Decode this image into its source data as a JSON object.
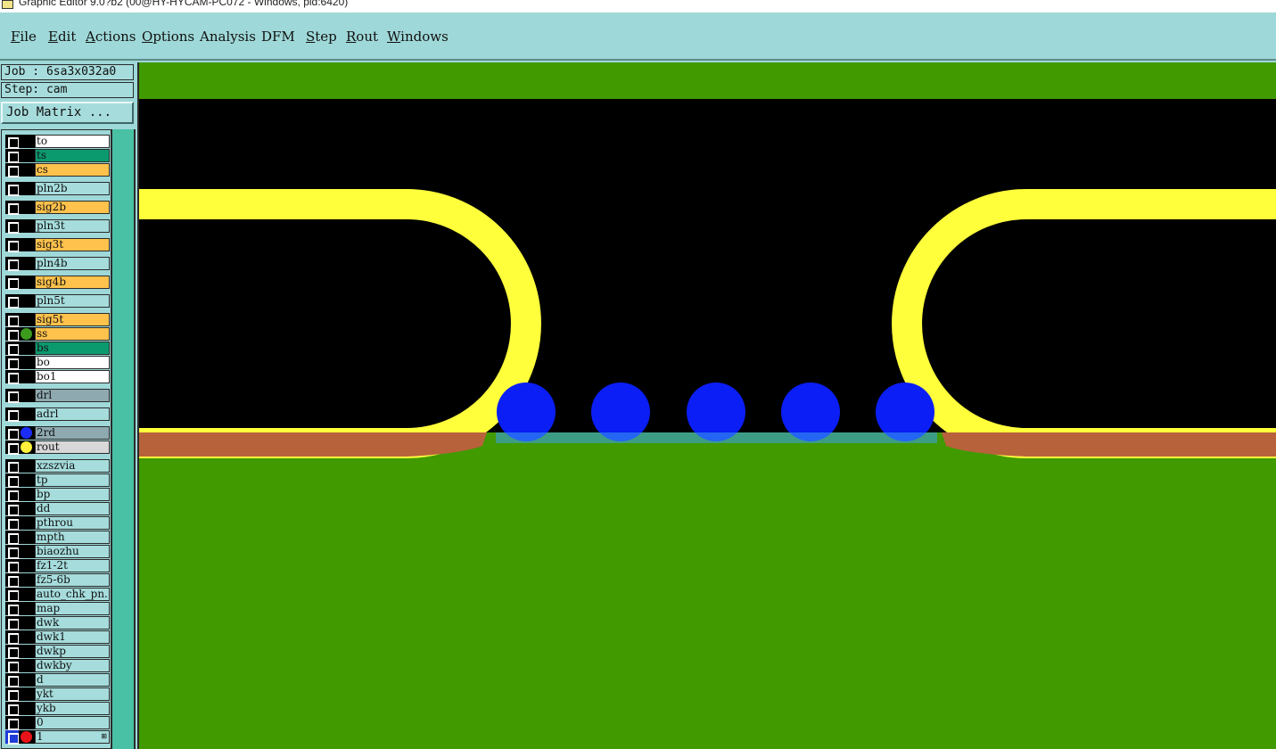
{
  "window": {
    "title": "Graphic Editor 9.0?b2 (00@HY-HYCAM-PC072 - Windows, pid:6420)"
  },
  "menu": [
    {
      "label": "File",
      "underline": "F",
      "rest": "ile"
    },
    {
      "label": "Edit",
      "underline": "E",
      "rest": "dit"
    },
    {
      "label": "Actions",
      "underline": "A",
      "rest": "ctions"
    },
    {
      "label": "Options",
      "underline": "O",
      "rest": "ptions"
    },
    {
      "label": "Analysis",
      "underline": "",
      "rest": "Analysis"
    },
    {
      "label": "DFM",
      "underline": "",
      "rest": "DFM"
    },
    {
      "label": "Step",
      "underline": "S",
      "rest": "tep"
    },
    {
      "label": "Rout",
      "underline": "R",
      "rest": "out"
    },
    {
      "label": "Windows",
      "underline": "W",
      "rest": "indows"
    }
  ],
  "job": {
    "job_line": "Job : 6sa3x032a0",
    "step_line": "Step: cam",
    "matrix_button": "Job Matrix ..."
  },
  "layers": [
    {
      "name": "to",
      "bg": "#ffffff",
      "dot": ""
    },
    {
      "name": "ts",
      "bg": "#0b9a6e",
      "dot": ""
    },
    {
      "name": "cs",
      "bg": "#ffc24c",
      "dot": ""
    },
    {
      "name": "pln2b",
      "bg": "#a6dcdc",
      "dot": ""
    },
    {
      "name": "sig2b",
      "bg": "#ffc24c",
      "dot": ""
    },
    {
      "name": "pln3t",
      "bg": "#a6dcdc",
      "dot": ""
    },
    {
      "name": "sig3t",
      "bg": "#ffc24c",
      "dot": ""
    },
    {
      "name": "pln4b",
      "bg": "#a6dcdc",
      "dot": ""
    },
    {
      "name": "sig4b",
      "bg": "#ffc24c",
      "dot": ""
    },
    {
      "name": "pln5t",
      "bg": "#a6dcdc",
      "dot": ""
    },
    {
      "name": "sig5t",
      "bg": "#ffc24c",
      "dot": ""
    },
    {
      "name": "ss",
      "bg": "#ffc24c",
      "dot": "#3c9a1c"
    },
    {
      "name": "bs",
      "bg": "#0b9a6e",
      "dot": ""
    },
    {
      "name": "bo",
      "bg": "#ffffff",
      "dot": ""
    },
    {
      "name": "bo1",
      "bg": "#ffffff",
      "dot": ""
    },
    {
      "name": "drl",
      "bg": "#8fa9b0",
      "dot": ""
    },
    {
      "name": "adrl",
      "bg": "#a6dcdc",
      "dot": ""
    },
    {
      "name": "2rd",
      "bg": "#8fa9b0",
      "dot": "#1a2cf5"
    },
    {
      "name": "rout",
      "bg": "#d8d8d8",
      "dot": "#fff13c"
    },
    {
      "name": "xzszvia",
      "bg": "#a6dcdc",
      "dot": ""
    },
    {
      "name": "tp",
      "bg": "#a6dcdc",
      "dot": ""
    },
    {
      "name": "bp",
      "bg": "#a6dcdc",
      "dot": ""
    },
    {
      "name": "dd",
      "bg": "#a6dcdc",
      "dot": ""
    },
    {
      "name": "pthrou",
      "bg": "#a6dcdc",
      "dot": ""
    },
    {
      "name": "mpth",
      "bg": "#a6dcdc",
      "dot": ""
    },
    {
      "name": "biaozhu",
      "bg": "#a6dcdc",
      "dot": ""
    },
    {
      "name": "fz1-2t",
      "bg": "#a6dcdc",
      "dot": ""
    },
    {
      "name": "fz5-6b",
      "bg": "#a6dcdc",
      "dot": ""
    },
    {
      "name": "auto_chk_pn.",
      "bg": "#a6dcdc",
      "dot": ""
    },
    {
      "name": "map",
      "bg": "#a6dcdc",
      "dot": ""
    },
    {
      "name": "dwk",
      "bg": "#a6dcdc",
      "dot": ""
    },
    {
      "name": "dwk1",
      "bg": "#a6dcdc",
      "dot": ""
    },
    {
      "name": "dwkp",
      "bg": "#a6dcdc",
      "dot": ""
    },
    {
      "name": "dwkby",
      "bg": "#a6dcdc",
      "dot": ""
    },
    {
      "name": "d",
      "bg": "#a6dcdc",
      "dot": ""
    },
    {
      "name": "ykt",
      "bg": "#a6dcdc",
      "dot": ""
    },
    {
      "name": "ykb",
      "bg": "#a6dcdc",
      "dot": ""
    },
    {
      "name": "0",
      "bg": "#a6dcdc",
      "dot": ""
    },
    {
      "name": "1",
      "bg": "#a6dcdc",
      "dot": "#e8141a",
      "selected": true,
      "mark": "⊞"
    }
  ],
  "colors": {
    "background": "#9fd8d8",
    "board_green": "#409a00",
    "rout_black": "#000000",
    "outline_yellow": "#ffff3c",
    "copper_brown": "#b8623c",
    "drill_blue": "#0a1ef5"
  }
}
